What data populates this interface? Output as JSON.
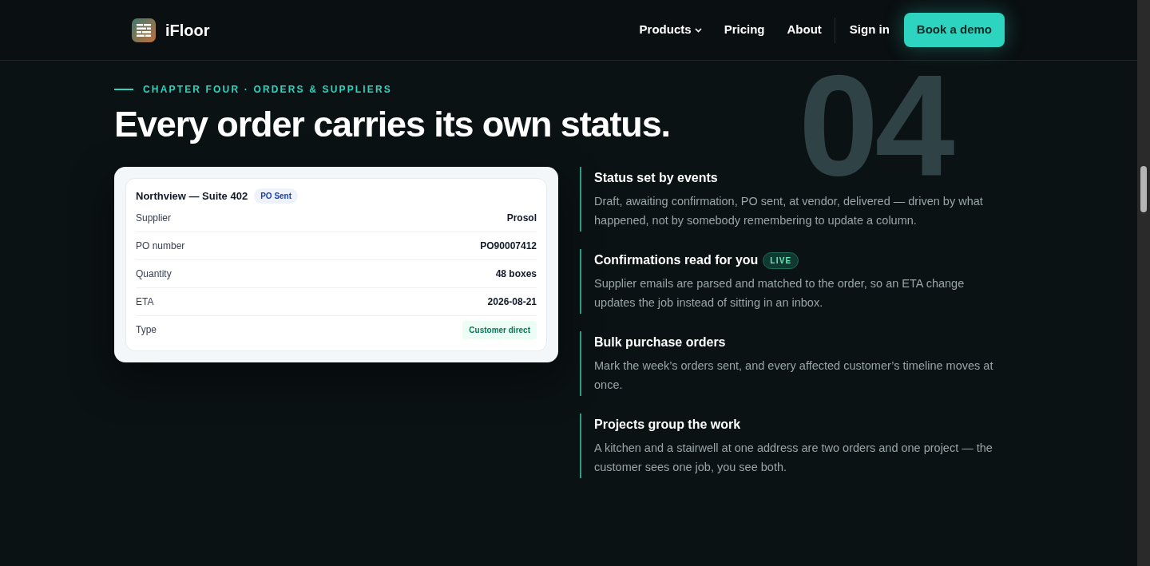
{
  "header": {
    "brand": "iFloor",
    "nav": [
      {
        "label": "Products",
        "kind": "dropdown"
      },
      {
        "label": "Pricing",
        "kind": "link"
      },
      {
        "label": "About",
        "kind": "link"
      }
    ],
    "sign_in": "Sign in",
    "cta": "Book a demo"
  },
  "backdrop_number": "04",
  "eyebrow": "CHAPTER FOUR · ORDERS & SUPPLIERS",
  "headline": "Every order carries its own status.",
  "order_card": {
    "title": "Northview — Suite 402",
    "status": "PO Sent",
    "rows": [
      {
        "label": "Supplier",
        "value": "Prosol",
        "kind": "text"
      },
      {
        "label": "PO number",
        "value": "PO90007412",
        "kind": "text"
      },
      {
        "label": "Quantity",
        "value": "48 boxes",
        "kind": "text"
      },
      {
        "label": "ETA",
        "value": "2026-08-21",
        "kind": "text"
      },
      {
        "label": "Type",
        "value": "Customer direct",
        "kind": "tag"
      }
    ]
  },
  "features": [
    {
      "title": "Status set by events",
      "body": "Draft, awaiting confirmation, PO sent, at vendor, delivered — driven by what happened, not by somebody remembering to update a column."
    },
    {
      "title": "Confirmations read for you",
      "badge": "LIVE",
      "body": "Supplier emails are parsed and matched to the order, so an ETA change updates the job instead of sitting in an inbox."
    },
    {
      "title": "Bulk purchase orders",
      "body": "Mark the week’s orders sent, and every affected customer’s timeline moves at once."
    },
    {
      "title": "Projects group the work",
      "body": "A kitchen and a stairwell at one address are two orders and one project — the customer sees one job, you see both."
    }
  ]
}
